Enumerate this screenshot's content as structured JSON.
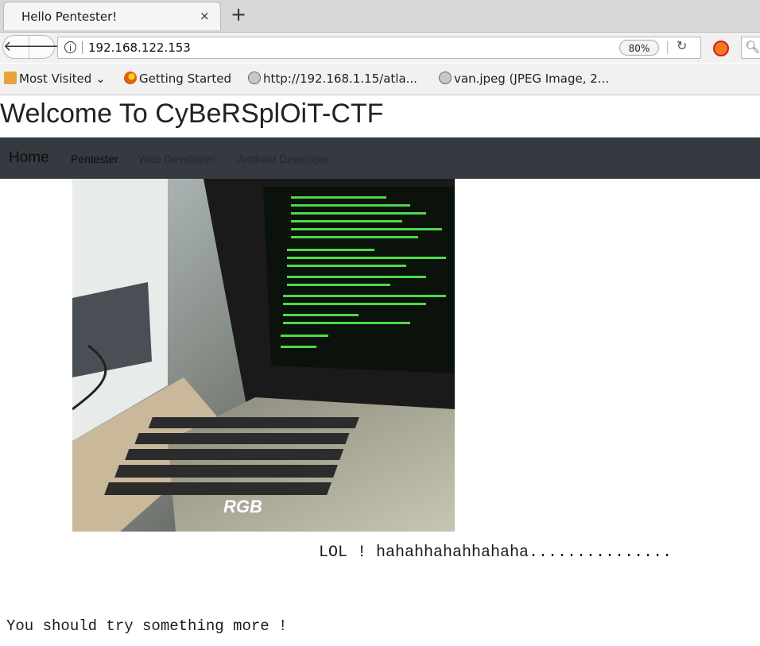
{
  "browser": {
    "tab_title": "Hello Pentester!",
    "tab_close": "×",
    "new_tab": "+",
    "url": "192.168.122.153",
    "zoom": "80%",
    "bookmarks": [
      {
        "label": "Most Visited",
        "icon": "folder-icon"
      },
      {
        "label": "Getting Started",
        "icon": "firefox-icon"
      },
      {
        "label": "http://192.168.1.15/atla...",
        "icon": "globe-icon"
      },
      {
        "label": "van.jpeg (JPEG Image, 2...",
        "icon": "globe-icon"
      }
    ]
  },
  "page": {
    "title": "Welcome To CyBeRSplOiT-CTF",
    "nav": {
      "home": "Home",
      "links": [
        "Pentester",
        "Web Developer",
        "Android Developer"
      ]
    },
    "image_caption_logo": "RGB",
    "lol": "LOL ! hahahhahahhahaha...............",
    "try_more": "You should try something more !"
  }
}
